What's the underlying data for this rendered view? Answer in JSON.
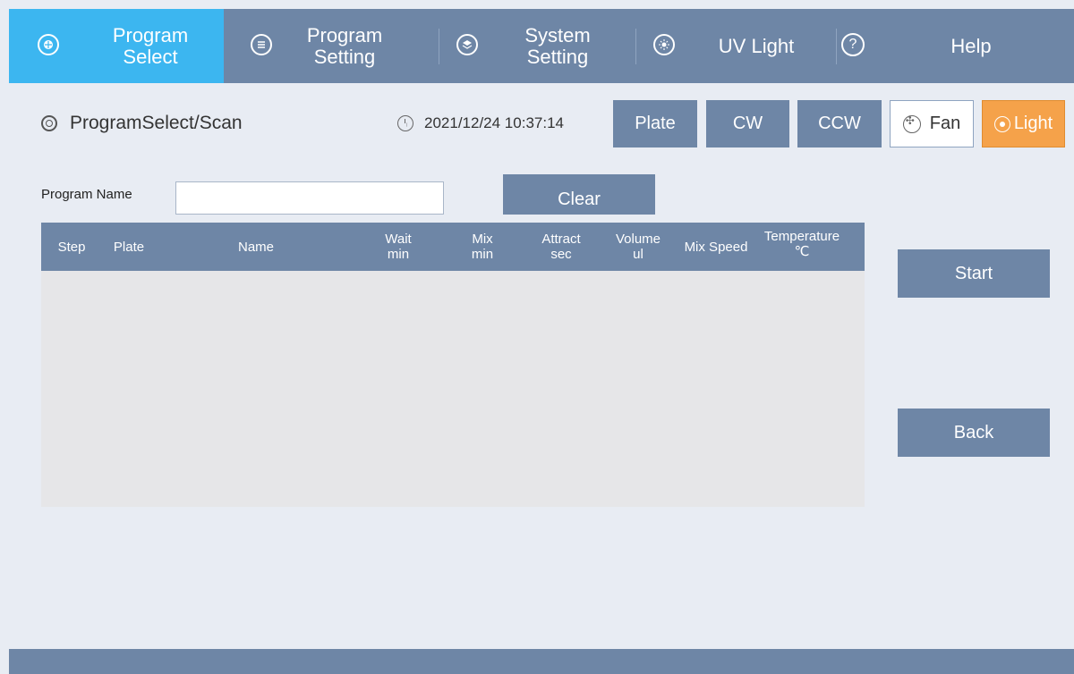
{
  "nav": {
    "tabs": [
      {
        "line1": "Program",
        "line2": "Select",
        "icon": "program-select-icon",
        "active": true
      },
      {
        "line1": "Program",
        "line2": "Setting",
        "icon": "program-setting-icon",
        "active": false
      },
      {
        "line1": "System",
        "line2": "Setting",
        "icon": "system-setting-icon",
        "active": false
      },
      {
        "line1": "UV Light",
        "line2": "",
        "icon": "uv-light-icon",
        "active": false
      },
      {
        "line1": "Help",
        "line2": "",
        "icon": "help-icon",
        "active": false
      }
    ]
  },
  "header": {
    "breadcrumb": "ProgramSelect/Scan",
    "datetime": "2021/12/24 10:37:14",
    "buttons": {
      "plate": "Plate",
      "cw": "CW",
      "ccw": "CCW",
      "fan": "Fan",
      "light": "Light"
    }
  },
  "program": {
    "name_label": "Program Name",
    "name_value": "",
    "clear_label": "Clear"
  },
  "table": {
    "columns": [
      {
        "line1": "Step",
        "line2": ""
      },
      {
        "line1": "Plate",
        "line2": ""
      },
      {
        "line1": "Name",
        "line2": ""
      },
      {
        "line1": "Wait",
        "line2": "min"
      },
      {
        "line1": "Mix",
        "line2": "min"
      },
      {
        "line1": "Attract",
        "line2": "sec"
      },
      {
        "line1": "Volume",
        "line2": "ul"
      },
      {
        "line1": "Mix Speed",
        "line2": ""
      },
      {
        "line1": "Temperature",
        "line2": "℃"
      }
    ],
    "rows": []
  },
  "actions": {
    "start": "Start",
    "back": "Back"
  },
  "colors": {
    "nav_bg": "#6e86a6",
    "nav_active": "#3cb6f0",
    "light_active": "#f5a24a",
    "page_bg": "#e8ecf3"
  }
}
